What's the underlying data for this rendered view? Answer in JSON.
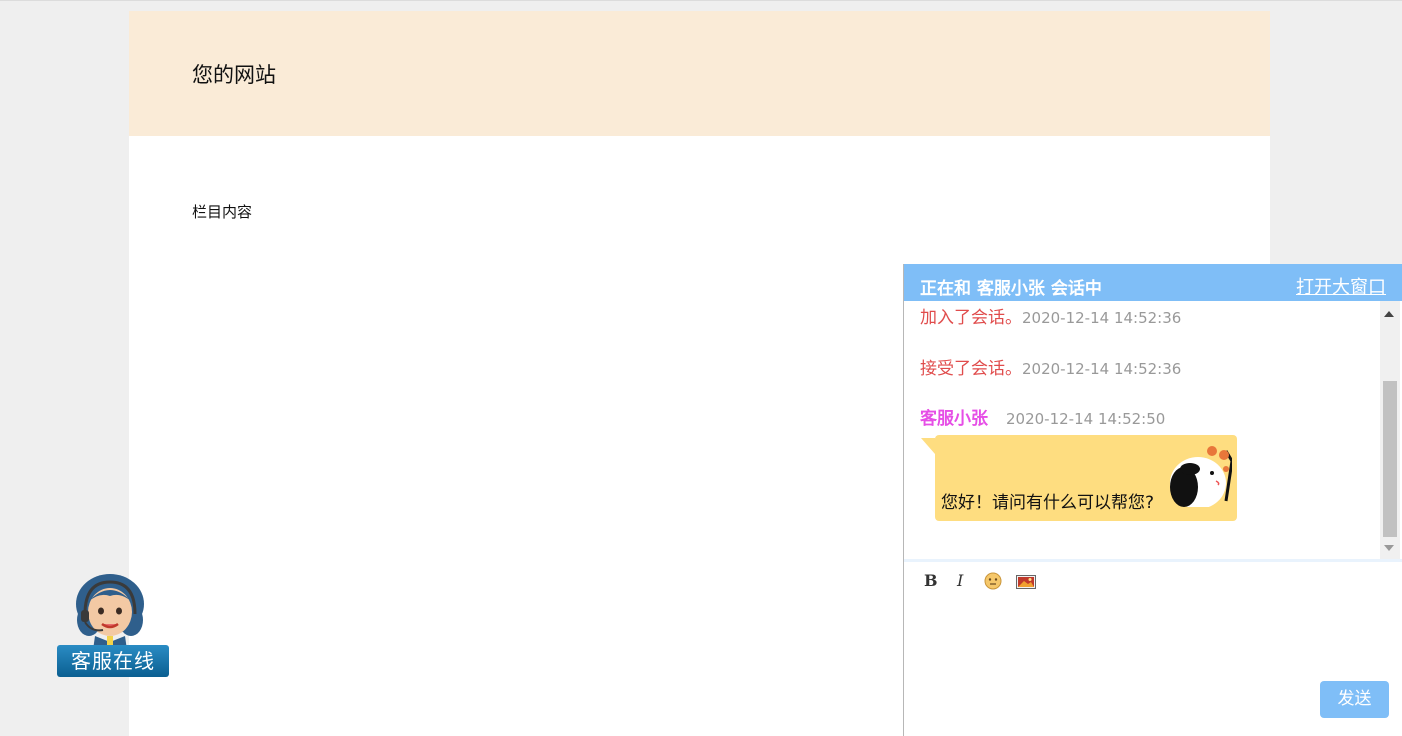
{
  "site": {
    "title": "您的网站",
    "column_content": "栏目内容"
  },
  "float_service": {
    "label": "客服在线",
    "icon": "agent-headset-icon"
  },
  "chat": {
    "header": {
      "title": "正在和 客服小张 会话中",
      "open_window_label": "打开大窗口"
    },
    "system_messages": [
      {
        "text": "加入了会话。",
        "time": "2020-12-14 14:52:36"
      },
      {
        "text": "接受了会话。",
        "time": "2020-12-14 14:52:36"
      }
    ],
    "message": {
      "sender": "客服小张",
      "time": "2020-12-14 14:52:50",
      "text": "您好！请问有什么可以帮您?",
      "sticker": "panda-sticker-icon"
    },
    "toolbar": {
      "bold": "B",
      "italic": "I",
      "emoji_icon": "emoji-icon",
      "image_icon": "image-icon"
    },
    "send_label": "发送"
  },
  "colors": {
    "header_bg": "#faebd7",
    "chat_header": "#7fbef7",
    "system_text": "#e04c4c",
    "sender_name": "#e64ee6",
    "bubble": "#fedd80"
  }
}
